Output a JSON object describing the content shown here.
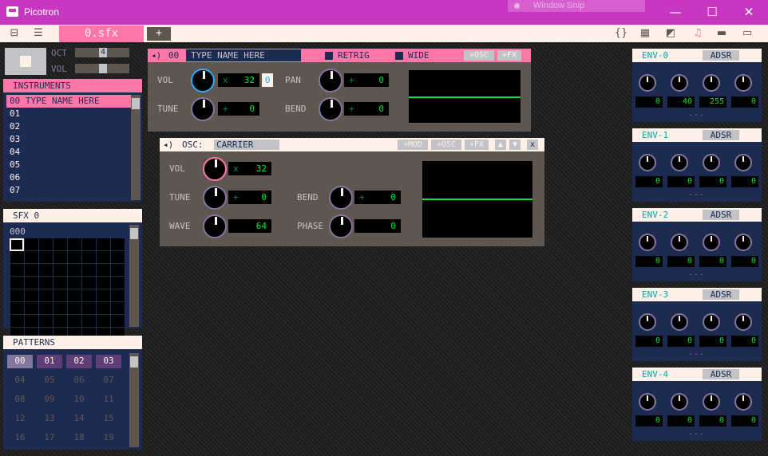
{
  "window": {
    "title": "Picotron",
    "ghost": "Window Snip",
    "min": "—",
    "max": "☐",
    "close": "✕"
  },
  "toolbar": {
    "file_tab": "0.sfx",
    "add_tab": "+",
    "tools": [
      "{}",
      "▦",
      "◩",
      "♫",
      "▬",
      "▭"
    ]
  },
  "player": {
    "oct_label": "OCT",
    "oct_value": "4",
    "vol_label": "VOL"
  },
  "instruments": {
    "title": "INSTRUMENTS",
    "items": [
      "00 TYPE NAME HERE",
      "01",
      "02",
      "03",
      "04",
      "05",
      "06",
      "07"
    ]
  },
  "sfx": {
    "title": "SFX 0",
    "index": "000"
  },
  "patterns": {
    "title": "PATTERNS",
    "items": [
      "00",
      "01",
      "02",
      "03",
      "04",
      "05",
      "06",
      "07",
      "08",
      "09",
      "10",
      "11",
      "12",
      "13",
      "14",
      "15",
      "16",
      "17",
      "18",
      "19"
    ]
  },
  "instrument_panel": {
    "index": "00",
    "name": "TYPE NAME HERE",
    "retrig": "RETRIG",
    "wide": "WIDE",
    "add_osc": "+OSC",
    "add_fx": "+FX",
    "vol_label": "VOL",
    "vol_value": "32",
    "vol_mult": "0",
    "pan_label": "PAN",
    "pan_value": "0",
    "tune_label": "TUNE",
    "tune_value": "0",
    "bend_label": "BEND",
    "bend_value": "0"
  },
  "osc_panel": {
    "label": "OSC:",
    "name": "CARRIER",
    "add_mod": "+MOD",
    "add_osc": "+OSC",
    "add_fx": "+FX",
    "up": "▲",
    "down": "▼",
    "close": "x",
    "vol_label": "VOL",
    "vol_value": "32",
    "tune_label": "TUNE",
    "tune_value": "0",
    "bend_label": "BEND",
    "bend_value": "0",
    "wave_label": "WAVE",
    "wave_value": "64",
    "phase_label": "PHASE",
    "phase_value": "0"
  },
  "envelopes": [
    {
      "title": "ENV-0",
      "type": "ADSR",
      "values": [
        "0",
        "40",
        "255",
        "0"
      ]
    },
    {
      "title": "ENV-1",
      "type": "ADSR",
      "values": [
        "0",
        "0",
        "0",
        "0"
      ]
    },
    {
      "title": "ENV-2",
      "type": "ADSR",
      "values": [
        "0",
        "0",
        "0",
        "0"
      ]
    },
    {
      "title": "ENV-3",
      "type": "ADSR",
      "values": [
        "0",
        "0",
        "0",
        "0"
      ]
    },
    {
      "title": "ENV-4",
      "type": "ADSR",
      "values": [
        "0",
        "0",
        "0",
        "0"
      ]
    }
  ],
  "env_more": "...",
  "colors": {
    "titlebar": "#c837c2",
    "accent": "#ff77a8",
    "navy": "#1d2b53",
    "green": "#00e436",
    "panel": "#5f574f"
  }
}
